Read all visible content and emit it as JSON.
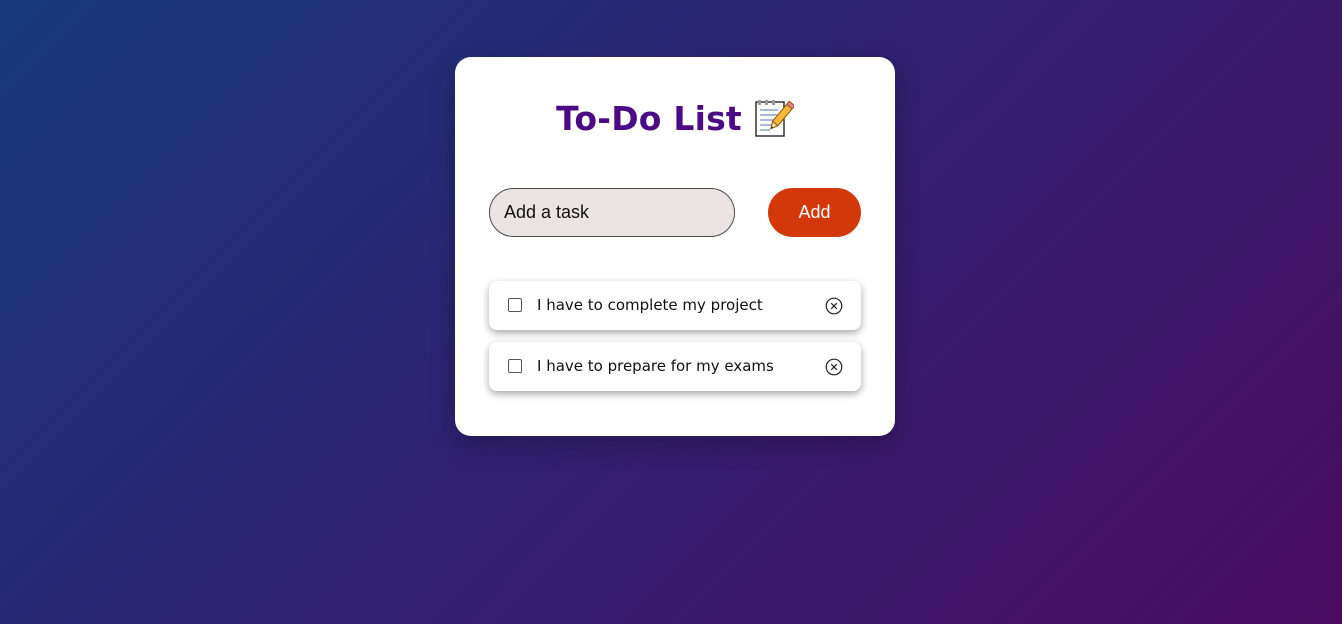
{
  "header": {
    "title": "To-Do List",
    "title_icon": "memo-pencil-icon"
  },
  "input": {
    "placeholder": "Add a task",
    "value": ""
  },
  "add_button": {
    "label": "Add"
  },
  "tasks": [
    {
      "text": "I have to complete my project",
      "checked": false
    },
    {
      "text": "I have to prepare for my exams",
      "checked": false
    }
  ],
  "colors": {
    "title": "#4b0b84",
    "add_button": "#d3380a",
    "input_bg": "#ebe2e2",
    "bg_start": "#173a7c",
    "bg_end": "#4a0c62"
  }
}
